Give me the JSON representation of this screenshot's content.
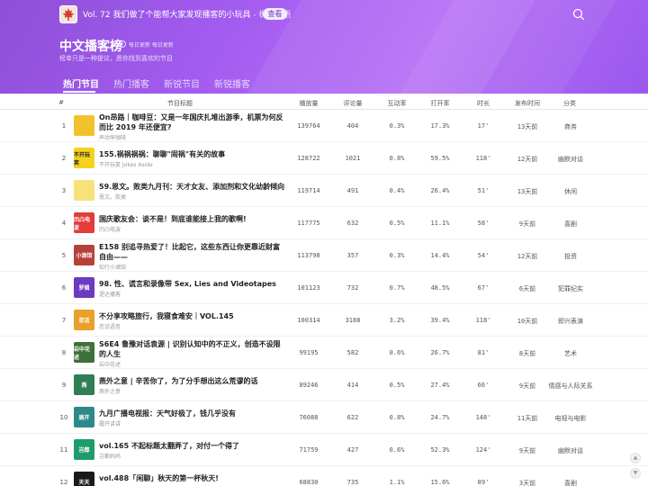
{
  "header": {
    "announcement_main": "Vol. 72 我们做了个能帮大家发现播客的小玩具",
    "announcement_suffix": " - 枫言枫语",
    "view_button": "查看"
  },
  "page": {
    "title": "中文播客榜",
    "update_note": "每日更新 每日更新",
    "subtitle": "榜单只是一种提议，愿你找到喜欢的节目"
  },
  "tabs": [
    {
      "label": "热门节目",
      "active": true
    },
    {
      "label": "热门播客",
      "active": false
    },
    {
      "label": "新锐节目",
      "active": false
    },
    {
      "label": "新锐播客",
      "active": false
    }
  ],
  "columns": [
    "#",
    "节目标题",
    "播放量",
    "评论量",
    "互动率",
    "打开率",
    "时长",
    "发布时间",
    "分类"
  ],
  "rows": [
    {
      "rank": "1",
      "title": "On昂路｜咖啡豆：又是一年国庆扎堆出游季，机票为何反而比 2019 年还便宜?",
      "podcast": "声动早咖啡",
      "plays": "139764",
      "comments": "404",
      "interact": "0.3%",
      "open": "17.3%",
      "duration": "17'",
      "published": "13天前",
      "category": "商务",
      "cover_color": "#f2c22e",
      "cover_text": ""
    },
    {
      "rank": "2",
      "title": "155.祸祸祸祸：聊聊\"闹祸\"有关的故事",
      "podcast": "不开玩笑 Jokes Aside",
      "plays": "128722",
      "comments": "1021",
      "interact": "0.8%",
      "open": "59.5%",
      "duration": "118'",
      "published": "12天前",
      "category": "幽默对谈",
      "cover_color": "#f5d21e",
      "cover_text": "不开玩笑"
    },
    {
      "rank": "3",
      "title": "59.恩文。败类九月刊：天才女友、添加剂和文化幼龄倾向",
      "podcast": "恩文。败类",
      "plays": "119714",
      "comments": "491",
      "interact": "0.4%",
      "open": "26.4%",
      "duration": "51'",
      "published": "13天前",
      "category": "休闲",
      "cover_color": "#f7e27a",
      "cover_text": ""
    },
    {
      "rank": "4",
      "title": "国庆歌友会：谈不是！到底谁能接上我的歌啊!",
      "podcast": "凹凸电波",
      "plays": "117775",
      "comments": "632",
      "interact": "0.5%",
      "open": "11.1%",
      "duration": "58'",
      "published": "9天前",
      "category": "喜剧",
      "cover_color": "#e43b3b",
      "cover_text": "凹凸电波"
    },
    {
      "rank": "5",
      "title": "E158 别追寻热爱了！比起它，这些东西让你更靠近财富自由——",
      "podcast": "知行小酒馆",
      "plays": "113798",
      "comments": "357",
      "interact": "0.3%",
      "open": "14.4%",
      "duration": "54'",
      "published": "12天前",
      "category": "投资",
      "cover_color": "#b8403a",
      "cover_text": "小酒馆"
    },
    {
      "rank": "6",
      "title": "98. 性、谎言和录像带 Sex, Lies and Videotapes",
      "podcast": "逻达播客",
      "plays": "101123",
      "comments": "732",
      "interact": "0.7%",
      "open": "48.5%",
      "duration": "67'",
      "published": "6天前",
      "category": "犯罪纪实",
      "cover_color": "#6d3bc2",
      "cover_text": "罗辑"
    },
    {
      "rank": "7",
      "title": "不分享攻略旅行，我寝食难安｜VOL.145",
      "podcast": "忽话语音",
      "plays": "100314",
      "comments": "3188",
      "interact": "3.2%",
      "open": "39.4%",
      "duration": "118'",
      "published": "10天前",
      "category": "即兴表演",
      "cover_color": "#e8a12a",
      "cover_text": "忽话"
    },
    {
      "rank": "8",
      "title": "S6E4 鲁豫对话袁源 | 识别认知中的不正义，创造不设限的人生",
      "podcast": "岩中花述",
      "plays": "99195",
      "comments": "582",
      "interact": "0.6%",
      "open": "26.7%",
      "duration": "81'",
      "published": "8天前",
      "category": "艺术",
      "cover_color": "#3f6f3a",
      "cover_text": "岩中花述"
    },
    {
      "rank": "9",
      "title": "燕外之意 | 辛苦你了，为了分手想出这么荒谬的话",
      "podcast": "燕外之意",
      "plays": "89246",
      "comments": "414",
      "interact": "0.5%",
      "open": "27.4%",
      "duration": "66'",
      "published": "9天前",
      "category": "情感与人际关系",
      "cover_color": "#2f7f55",
      "cover_text": "燕"
    },
    {
      "rank": "10",
      "title": "九月广播电视报：天气好极了，钱几乎没有",
      "podcast": "履开讲讲",
      "plays": "76088",
      "comments": "622",
      "interact": "0.8%",
      "open": "24.7%",
      "duration": "148'",
      "published": "11天前",
      "category": "电视与电影",
      "cover_color": "#2e8a8a",
      "cover_text": "展开"
    },
    {
      "rank": "11",
      "title": "vol.165 不起标题太翻弄了，对付一个得了",
      "podcast": "岂都妈妈",
      "plays": "71759",
      "comments": "427",
      "interact": "0.6%",
      "open": "52.3%",
      "duration": "124'",
      "published": "9天前",
      "category": "幽默对谈",
      "cover_color": "#1f9c6b",
      "cover_text": "岂都"
    },
    {
      "rank": "12",
      "title": "vol.488「闲聊」秋天的第一杯秋天!",
      "podcast": "",
      "plays": "68830",
      "comments": "735",
      "interact": "1.1%",
      "open": "15.6%",
      "duration": "89'",
      "published": "3天前",
      "category": "喜剧",
      "cover_color": "#1a1a1a",
      "cover_text": "天天"
    }
  ],
  "side_buttons": [
    "▲",
    "▼"
  ]
}
